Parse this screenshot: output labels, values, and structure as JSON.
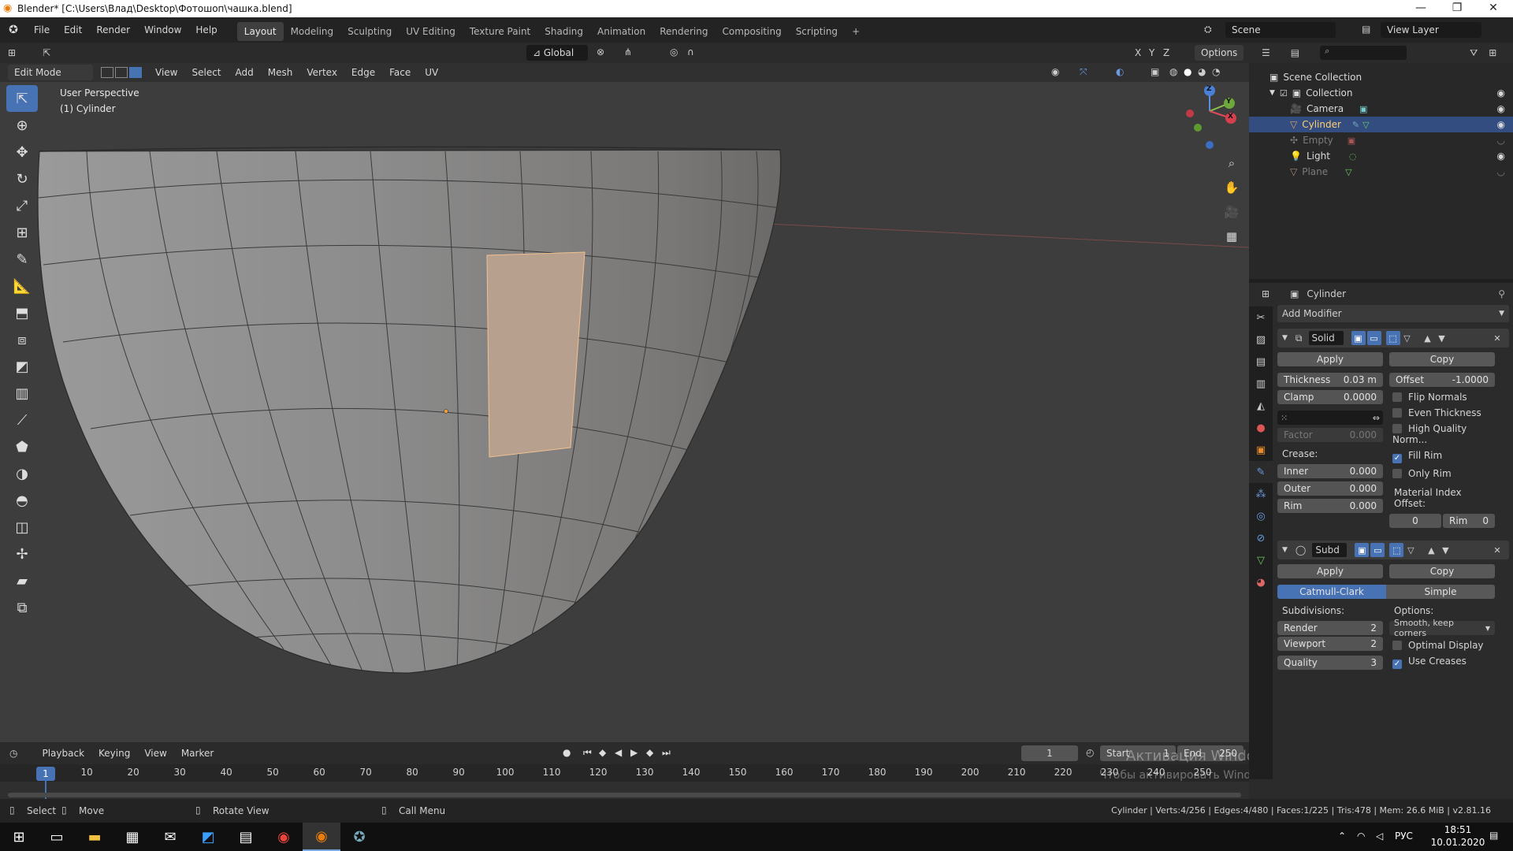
{
  "window": {
    "title": "Blender* [C:\\Users\\Влад\\Desktop\\Фотошоп\\чашка.blend]",
    "minimize": "—",
    "maximize": "❐",
    "close": "✕"
  },
  "menu": [
    "File",
    "Edit",
    "Render",
    "Window",
    "Help"
  ],
  "workspaces": [
    "Layout",
    "Modeling",
    "Sculpting",
    "UV Editing",
    "Texture Paint",
    "Shading",
    "Animation",
    "Rendering",
    "Compositing",
    "Scripting",
    "+"
  ],
  "scene": {
    "label": "Scene",
    "view_layer": "View Layer"
  },
  "viewport_header": {
    "transform": "Global",
    "options": "Options",
    "axes": [
      "X",
      "Y",
      "Z"
    ]
  },
  "mode_header": {
    "mode": "Edit Mode",
    "items": [
      "View",
      "Select",
      "Add",
      "Mesh",
      "Vertex",
      "Edge",
      "Face",
      "UV"
    ]
  },
  "overlay": {
    "line1": "User Perspective",
    "line2": "(1) Cylinder"
  },
  "gizmo": {
    "z": "Z",
    "y": "Y",
    "x": "X"
  },
  "tools": [
    "select-box",
    "cursor",
    "move",
    "rotate",
    "scale",
    "transform",
    "annotate",
    "measure",
    "extrude",
    "inset",
    "bevel",
    "loop-cut",
    "knife",
    "poly-build",
    "spin",
    "smooth",
    "edge-slide",
    "shrink-fatten",
    "shear",
    "rip"
  ],
  "outliner": {
    "root": "Scene Collection",
    "collection": "Collection",
    "items": [
      {
        "name": "Camera",
        "visible": true,
        "selected": false,
        "dim": false
      },
      {
        "name": "Cylinder",
        "visible": true,
        "selected": true,
        "dim": false
      },
      {
        "name": "Empty",
        "visible": false,
        "selected": false,
        "dim": true
      },
      {
        "name": "Light",
        "visible": true,
        "selected": false,
        "dim": false
      },
      {
        "name": "Plane",
        "visible": false,
        "selected": false,
        "dim": true
      }
    ]
  },
  "properties": {
    "object": "Cylinder",
    "add_modifier": "Add Modifier",
    "solidify": {
      "name": "Solid",
      "apply": "Apply",
      "copy": "Copy",
      "thickness_label": "Thickness",
      "thickness": "0.03 m",
      "offset_label": "Offset",
      "offset": "-1.0000",
      "clamp_label": "Clamp",
      "clamp": "0.0000",
      "factor_label": "Factor",
      "factor": "0.000",
      "flip_normals": "Flip Normals",
      "even_thickness": "Even Thickness",
      "high_quality": "High Quality Norm...",
      "fill_rim": "Fill Rim",
      "only_rim": "Only Rim",
      "crease": "Crease:",
      "inner_label": "Inner",
      "inner": "0.000",
      "outer_label": "Outer",
      "outer": "0.000",
      "rim_label": "Rim",
      "rim": "0.000",
      "material_offset": "Material Index Offset:",
      "mat_offset": "0",
      "mat_rim_label": "Rim",
      "mat_rim": "0"
    },
    "subsurf": {
      "name": "Subd",
      "apply": "Apply",
      "copy": "Copy",
      "catmull": "Catmull-Clark",
      "simple": "Simple",
      "subdivisions": "Subdivisions:",
      "options": "Options:",
      "render_label": "Render",
      "render": "2",
      "viewport_label": "Viewport",
      "viewport": "2",
      "quality_label": "Quality",
      "quality": "3",
      "uv_smooth": "Smooth, keep corners",
      "optimal_display": "Optimal Display",
      "use_creases": "Use Creases"
    }
  },
  "timeline": {
    "items": [
      "Playback",
      "Keying",
      "View",
      "Marker"
    ],
    "current_frame": "1",
    "start_label": "Start",
    "start": "1",
    "end_label": "End",
    "end": "250",
    "frame_marker": "1",
    "ticks": [
      "10",
      "20",
      "30",
      "40",
      "50",
      "60",
      "70",
      "80",
      "90",
      "100",
      "110",
      "120",
      "130",
      "140",
      "150",
      "160",
      "170",
      "180",
      "190",
      "200",
      "210",
      "220",
      "230",
      "240",
      "250"
    ]
  },
  "watermark": {
    "line1": "Активация Windows",
    "line2": "Чтобы активировать Windows, перейдите в раздел \"Параметры\"."
  },
  "status": {
    "select": "Select",
    "move": "Move",
    "rotate": "Rotate View",
    "call_menu": "Call Menu",
    "stats": "Cylinder | Verts:4/256 | Edges:4/480 | Faces:1/225 | Tris:478 | Mem: 26.6 MiB | v2.81.16"
  },
  "taskbar": {
    "lang": "РУС",
    "time": "18:51",
    "date": "10.01.2020"
  },
  "colors": {
    "accent": "#4772b3",
    "selected_face": "#b8a08e",
    "mesh": "#8e8e8e",
    "viewport_bg": "#3d3d3d"
  }
}
